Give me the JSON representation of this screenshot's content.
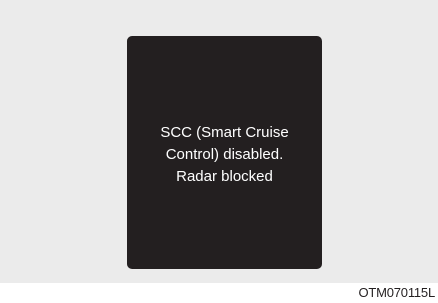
{
  "display": {
    "message_lines": [
      "SCC (Smart Cruise",
      "Control) disabled.",
      "Radar blocked"
    ]
  },
  "caption": "OTM070115L",
  "colors": {
    "background_panel": "#ebebeb",
    "display_bg": "#231f20",
    "display_text": "#ffffff"
  }
}
